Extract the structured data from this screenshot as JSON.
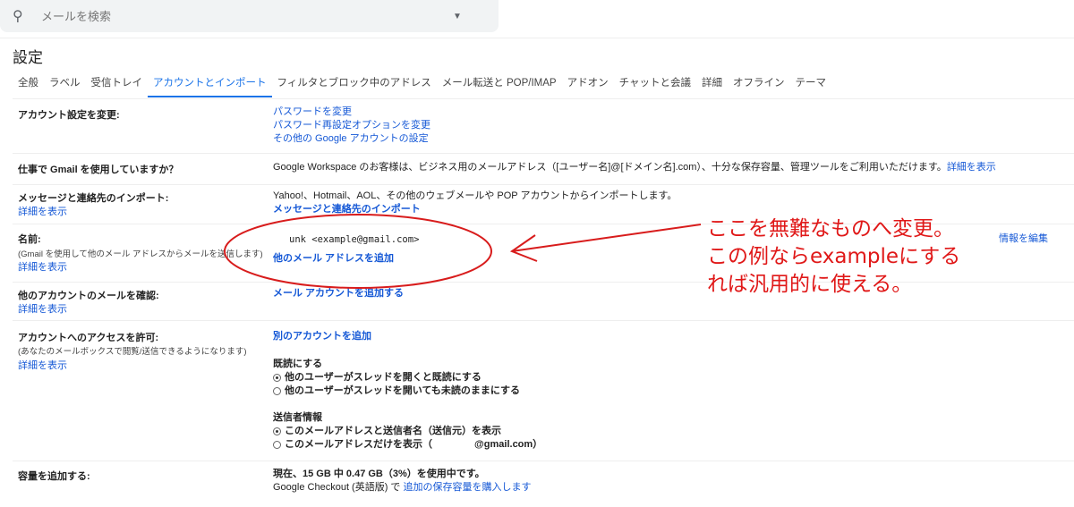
{
  "search": {
    "placeholder": "メールを検索"
  },
  "title": "設定",
  "tabs": [
    "全般",
    "ラベル",
    "受信トレイ",
    "アカウントとインポート",
    "フィルタとブロック中のアドレス",
    "メール転送と POP/IMAP",
    "アドオン",
    "チャットと会議",
    "詳細",
    "オフライン",
    "テーマ"
  ],
  "rows": {
    "account": {
      "label": "アカウント設定を変更:",
      "links": [
        "パスワードを変更",
        "パスワード再設定オプションを変更",
        "その他の Google アカウントの設定"
      ]
    },
    "work": {
      "label": "仕事で Gmail を使用していますか？",
      "text": "Google Workspace のお客様は、ビジネス用のメールアドレス（[ユーザー名]@[ドメイン名].com）、十分な保存容量、管理ツールをご利用いただけます。",
      "link": "詳細を表示"
    },
    "import": {
      "label": "メッセージと連絡先のインポート:",
      "more": "詳細を表示",
      "text": "Yahoo!、Hotmail、AOL、その他のウェブメールや POP アカウントからインポートします。",
      "link": "メッセージと連絡先のインポート"
    },
    "name": {
      "label": "名前:",
      "sub": "(Gmail を使用して他のメール アドレスからメールを送信します)",
      "more": "詳細を表示",
      "value": "unk  <example@gmail.com>",
      "add": "他のメール アドレスを追加",
      "edit": "情報を編集"
    },
    "check": {
      "label": "他のアカウントのメールを確認:",
      "more": "詳細を表示",
      "link": "メール アカウントを追加する"
    },
    "grant": {
      "label": "アカウントへのアクセスを許可:",
      "sub": "(あなたのメールボックスで閲覧/送信できるようになります)",
      "more": "詳細を表示",
      "link": "別のアカウントを追加",
      "read_title": "既読にする",
      "read_opts": [
        "他のユーザーがスレッドを開くと既読にする",
        "他のユーザーがスレッドを開いても未読のままにする"
      ],
      "sender_title": "送信者情報",
      "sender_opts": [
        "このメールアドレスと送信者名（送信元）を表示",
        "このメールアドレスだけを表示（　　　　 @gmail.com）"
      ]
    },
    "storage": {
      "label": "容量を追加する:",
      "usage": "現在、15 GB 中 0.47 GB（3%）を使用中です。",
      "checkout": "Google Checkout (英語版) で ",
      "buy": "追加の保存容量を購入します"
    }
  },
  "annotation": {
    "lines": [
      "ここを無難なものへ変更。",
      "この例ならexampleにする",
      "れば汎用的に使える。"
    ],
    "color": "#e01818"
  }
}
